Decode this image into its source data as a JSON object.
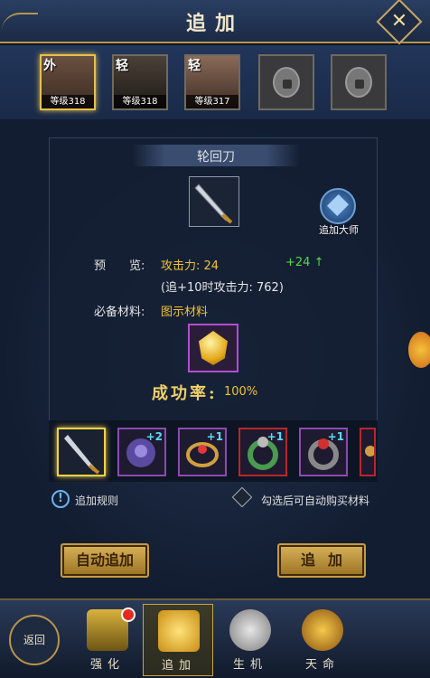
{
  "header": {
    "title": "追加",
    "close_icon": "crossed-swords-icon"
  },
  "characters": [
    {
      "class_char": "外",
      "level": "等级318",
      "selected": true
    },
    {
      "class_char": "轻",
      "level": "等级318",
      "selected": false
    },
    {
      "class_char": "轻",
      "level": "等级317",
      "selected": false
    },
    {
      "locked": true
    },
    {
      "locked": true
    }
  ],
  "item": {
    "name": "轮回刀"
  },
  "master": {
    "label": "追加大师"
  },
  "preview": {
    "label": "预　　览:",
    "stat": "攻击力: 24",
    "gain": "+24 ↑",
    "plus10": "(追+10时攻击力: 762)"
  },
  "materials": {
    "label": "必备材料:",
    "value": "图示材料"
  },
  "success": {
    "label": "成功率:",
    "value": "100%"
  },
  "equipment": [
    {
      "name": "blade",
      "plus": "",
      "selected": true
    },
    {
      "name": "armor",
      "plus": "+2"
    },
    {
      "name": "amulet",
      "plus": "+1"
    },
    {
      "name": "ring-green",
      "plus": "+1",
      "red": true
    },
    {
      "name": "ring-red",
      "plus": "+1"
    },
    {
      "name": "partial",
      "plus": "",
      "red": true
    }
  ],
  "rules": {
    "text": "追加规则"
  },
  "auto_buy": {
    "text": "勾选后可自动购买材料"
  },
  "buttons": {
    "auto": "自动追加",
    "add": "追加"
  },
  "nav": {
    "back": "返回",
    "tabs": [
      {
        "label": "强化"
      },
      {
        "label": "追加"
      },
      {
        "label": "生机"
      },
      {
        "label": "天命"
      }
    ]
  },
  "colors": {
    "gold": "#f2c231",
    "green": "#54d84a",
    "accent": "#c79b3d"
  }
}
